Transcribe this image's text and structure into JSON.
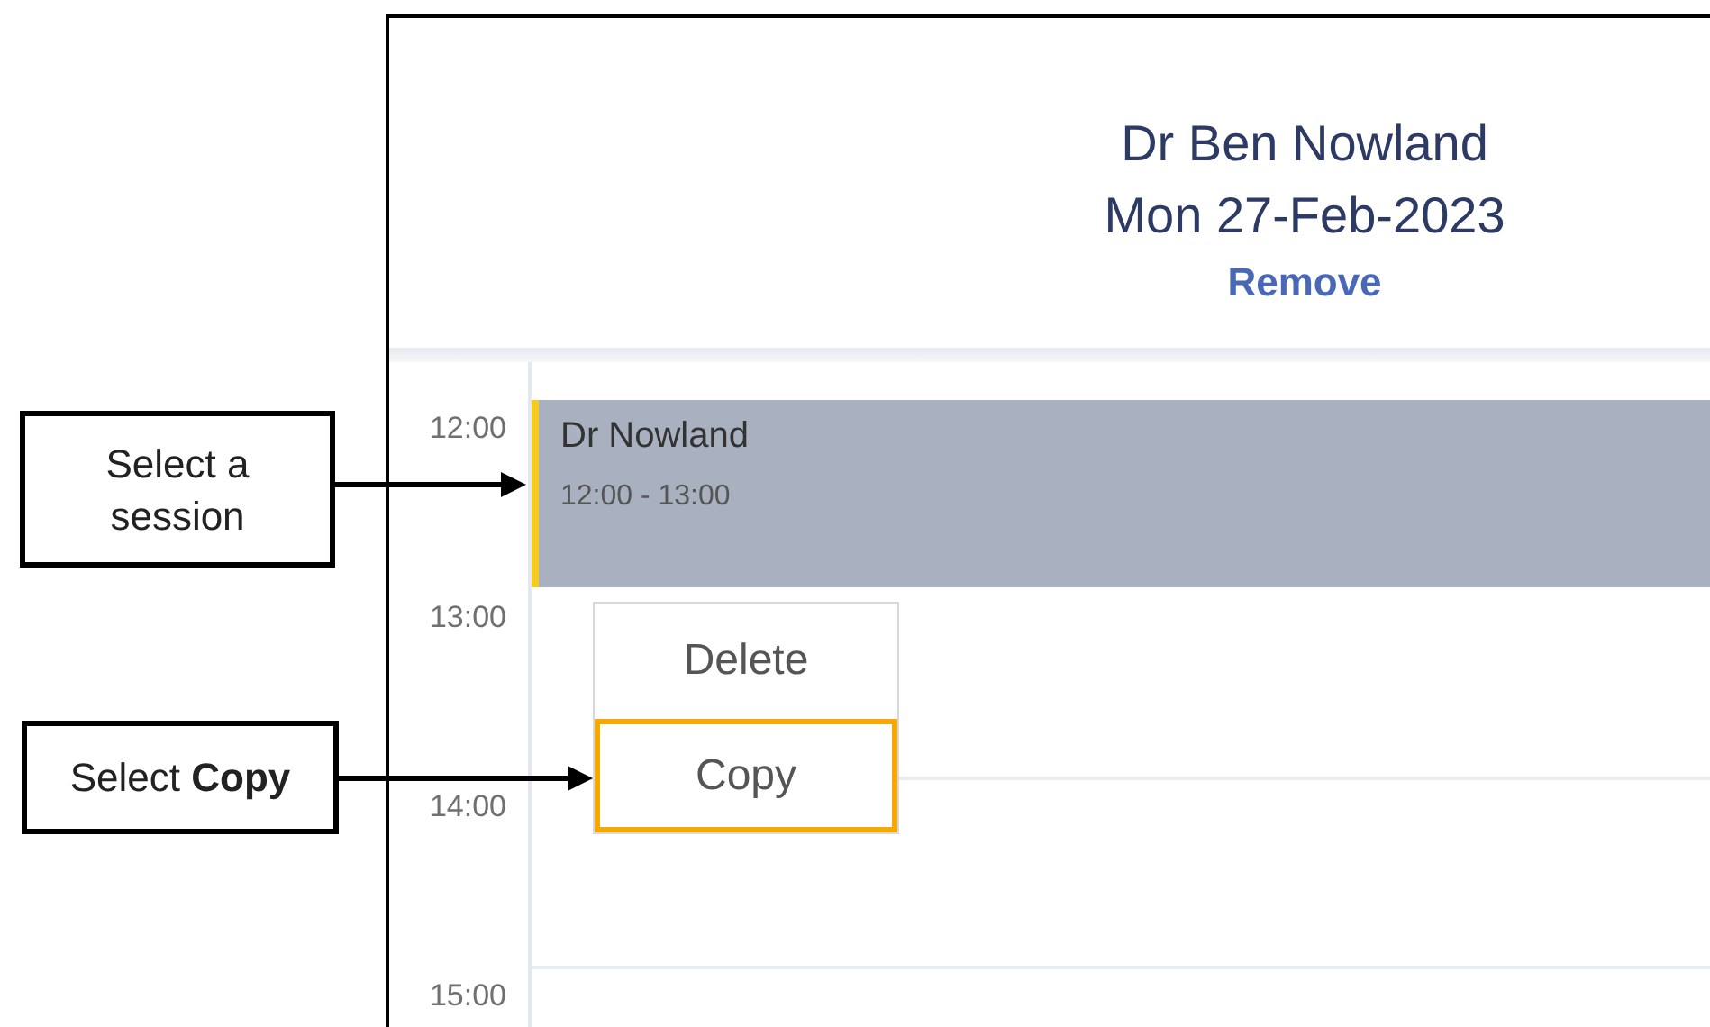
{
  "header": {
    "clinician": "Dr Ben Nowland",
    "date": "Mon 27-Feb-2023",
    "remove_link": "Remove"
  },
  "times": [
    "12:00",
    "13:00",
    "14:00",
    "15:00"
  ],
  "session": {
    "title": "Dr Nowland",
    "time_range": "12:00 - 13:00"
  },
  "context_menu": [
    {
      "label": "Delete",
      "highlighted": false
    },
    {
      "label": "Copy",
      "highlighted": true
    }
  ],
  "callouts": [
    "Select a session",
    "Select **Copy**"
  ]
}
